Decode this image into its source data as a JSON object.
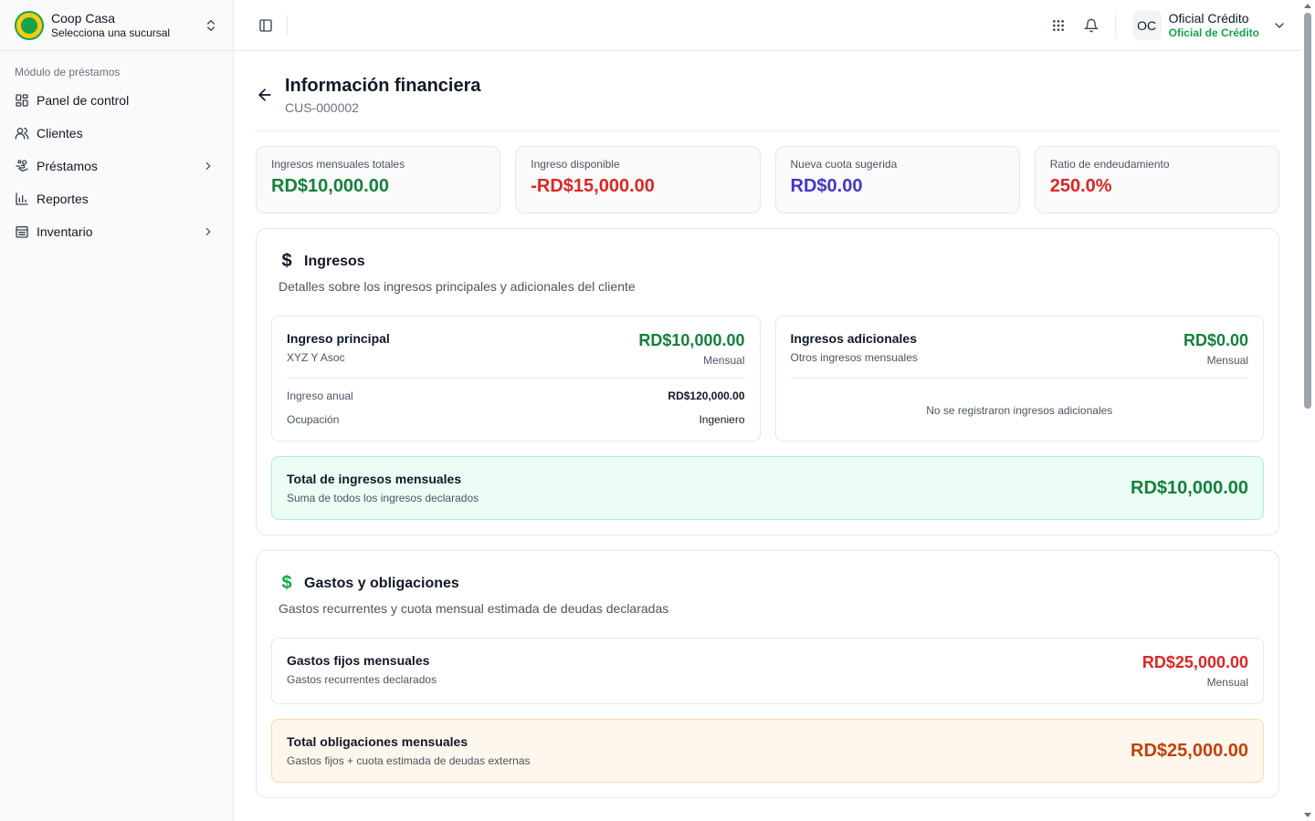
{
  "colors": {
    "green": "#15803d",
    "red": "#dc2626",
    "indigo": "#4338ca",
    "orange_dark": "#c2410c",
    "role_green": "#16a34a"
  },
  "org": {
    "name": "Coop Casa",
    "subtitle": "Selecciona una sucursal"
  },
  "sidebar": {
    "group_label": "Módulo de préstamos",
    "items": [
      {
        "label": "Panel de control",
        "icon": "dashboard-icon"
      },
      {
        "label": "Clientes",
        "icon": "users-icon"
      },
      {
        "label": "Préstamos",
        "icon": "loans-icon",
        "has_submenu": true
      },
      {
        "label": "Reportes",
        "icon": "chart-icon"
      },
      {
        "label": "Inventario",
        "icon": "inventory-icon",
        "has_submenu": true
      }
    ]
  },
  "user": {
    "initials": "OC",
    "name": "Oficial Crédito",
    "role": "Oficial de Crédito"
  },
  "page": {
    "title": "Información financiera",
    "subtitle": "CUS-000002"
  },
  "metrics": [
    {
      "label": "Ingresos mensuales totales",
      "value": "RD$10,000.00",
      "color": "#15803d"
    },
    {
      "label": "Ingreso disponible",
      "value": "-RD$15,000.00",
      "color": "#dc2626"
    },
    {
      "label": "Nueva cuota sugerida",
      "value": "RD$0.00",
      "color": "#4338ca"
    },
    {
      "label": "Ratio de endeudamiento",
      "value": "250.0%",
      "color": "#dc2626"
    }
  ],
  "income": {
    "title": "Ingresos",
    "description": "Detalles sobre los ingresos principales y adicionales del cliente",
    "principal": {
      "title": "Ingreso principal",
      "subtitle": "XYZ Y Asoc",
      "amount": "RD$10,000.00",
      "period": "Mensual",
      "annual_label": "Ingreso anual",
      "annual_value": "RD$120,000.00",
      "occupation_label": "Ocupación",
      "occupation_value": "Ingeniero"
    },
    "additional": {
      "title": "Ingresos adicionales",
      "subtitle": "Otros ingresos mensuales",
      "amount": "RD$0.00",
      "period": "Mensual",
      "empty": "No se registraron ingresos adicionales"
    },
    "total": {
      "title": "Total de ingresos mensuales",
      "subtitle": "Suma de todos los ingresos declarados",
      "amount": "RD$10,000.00"
    }
  },
  "expenses": {
    "title": "Gastos y obligaciones",
    "description": "Gastos recurrentes y cuota mensual estimada de deudas declaradas",
    "fixed": {
      "title": "Gastos fijos mensuales",
      "subtitle": "Gastos recurrentes declarados",
      "amount": "RD$25,000.00",
      "period": "Mensual"
    },
    "total": {
      "title": "Total obligaciones mensuales",
      "subtitle": "Gastos fijos + cuota estimada de deudas externas",
      "amount": "RD$25,000.00"
    }
  }
}
